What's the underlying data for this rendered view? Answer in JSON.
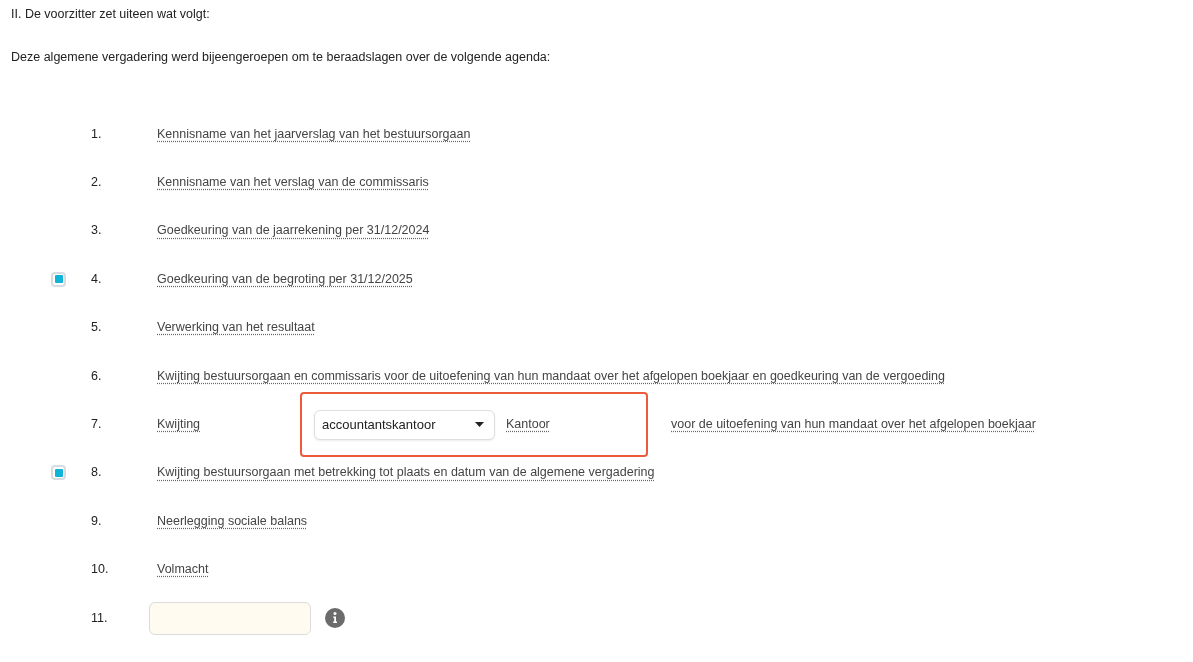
{
  "intro": [
    "II. De voorzitter zet uiteen wat volgt:",
    "Deze algemene vergadering werd bijeengeroepen om te beraadslagen over de volgende agenda:"
  ],
  "agenda": [
    {
      "number": "1.",
      "kind": "text",
      "checked": false,
      "text": "Kennisname van het jaarverslag van het bestuursorgaan"
    },
    {
      "number": "2.",
      "kind": "text",
      "checked": false,
      "text": "Kennisname van het verslag van de commissaris"
    },
    {
      "number": "3.",
      "kind": "text",
      "checked": false,
      "text": "Goedkeuring van de jaarrekening per 31/12/2024"
    },
    {
      "number": "4.",
      "kind": "text",
      "checked": true,
      "text": "Goedkeuring van de begroting per 31/12/2025"
    },
    {
      "number": "5.",
      "kind": "text",
      "checked": false,
      "text": "Verwerking van het resultaat"
    },
    {
      "number": "6.",
      "kind": "text",
      "checked": false,
      "text": "Kwijting bestuursorgaan en commissaris voor de uitoefening van hun mandaat over het afgelopen boekjaar en goedkeuring van de vergoeding"
    },
    {
      "number": "7.",
      "kind": "choice",
      "checked": false,
      "text": "Kwijting",
      "choice": {
        "highlighted": true,
        "select": {
          "value": "accountantskantoor"
        },
        "label": "Kantoor"
      },
      "suffix": "voor de uitoefening van hun mandaat over het afgelopen boekjaar"
    },
    {
      "number": "8.",
      "kind": "text",
      "checked": true,
      "text": "Kwijting bestuursorgaan met betrekking tot plaats en datum van de algemene vergadering"
    },
    {
      "number": "9.",
      "kind": "text",
      "checked": false,
      "text": "Neerlegging sociale balans"
    },
    {
      "number": "10.",
      "kind": "text",
      "checked": false,
      "text": "Volmacht"
    },
    {
      "number": "11.",
      "kind": "input",
      "checked": false
    }
  ]
}
